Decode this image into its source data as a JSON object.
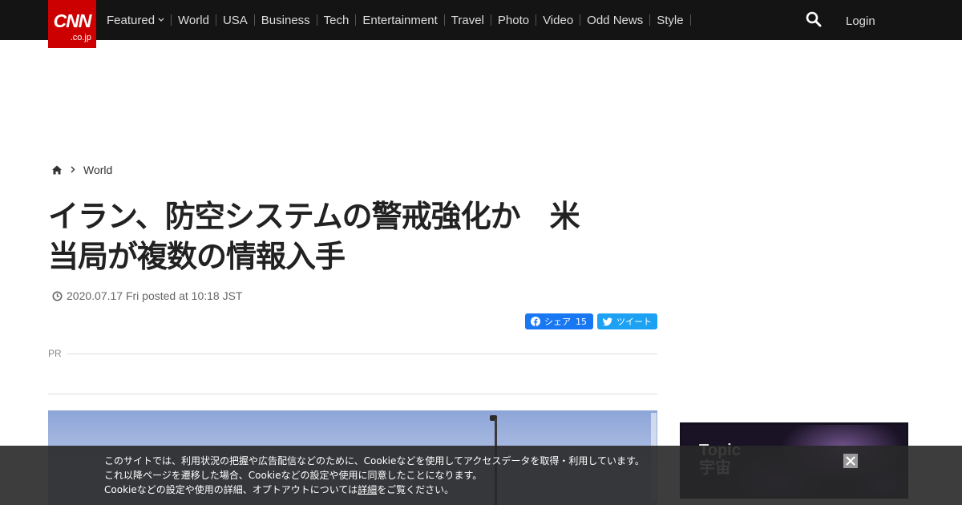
{
  "header": {
    "logo_main": "CNN",
    "logo_sub": ".co.jp",
    "nav": [
      {
        "label": "Featured",
        "has_dropdown": true
      },
      {
        "label": "World"
      },
      {
        "label": "USA"
      },
      {
        "label": "Business"
      },
      {
        "label": "Tech"
      },
      {
        "label": "Entertainment"
      },
      {
        "label": "Travel"
      },
      {
        "label": "Photo"
      },
      {
        "label": "Video"
      },
      {
        "label": "Odd News"
      },
      {
        "label": "Style"
      }
    ],
    "search_icon": "search-icon",
    "login_label": "Login"
  },
  "breadcrumb": {
    "home_icon": "home-icon",
    "section": "World"
  },
  "article": {
    "title_line1": "イラン、防空システムの警戒強化か　米",
    "title_line2": "当局が複数の情報入手",
    "date": "2020.07.17 Fri posted at 10:18 JST",
    "share_facebook": "シェア",
    "share_facebook_count": "15",
    "share_twitter": "ツイート",
    "pr_label": "PR"
  },
  "sidebar": {
    "topic_label_1": "Topic",
    "topic_label_2": "宇宙"
  },
  "cookie_banner": {
    "line1": "このサイトでは、利用状況の把握や広告配信などのために、Cookieなどを使用してアクセスデータを取得・利用しています。",
    "line2": "これ以降ページを遷移した場合、Cookieなどの設定や使用に同意したことになります。",
    "line3_before": "Cookieなどの設定や使用の詳細、オプトアウトについては",
    "line3_link": "詳細",
    "line3_after": "をご覧ください。"
  },
  "colors": {
    "brand_red": "#cc0000",
    "topbar": "#141414",
    "facebook": "#1877f2",
    "twitter": "#1da1f2"
  }
}
